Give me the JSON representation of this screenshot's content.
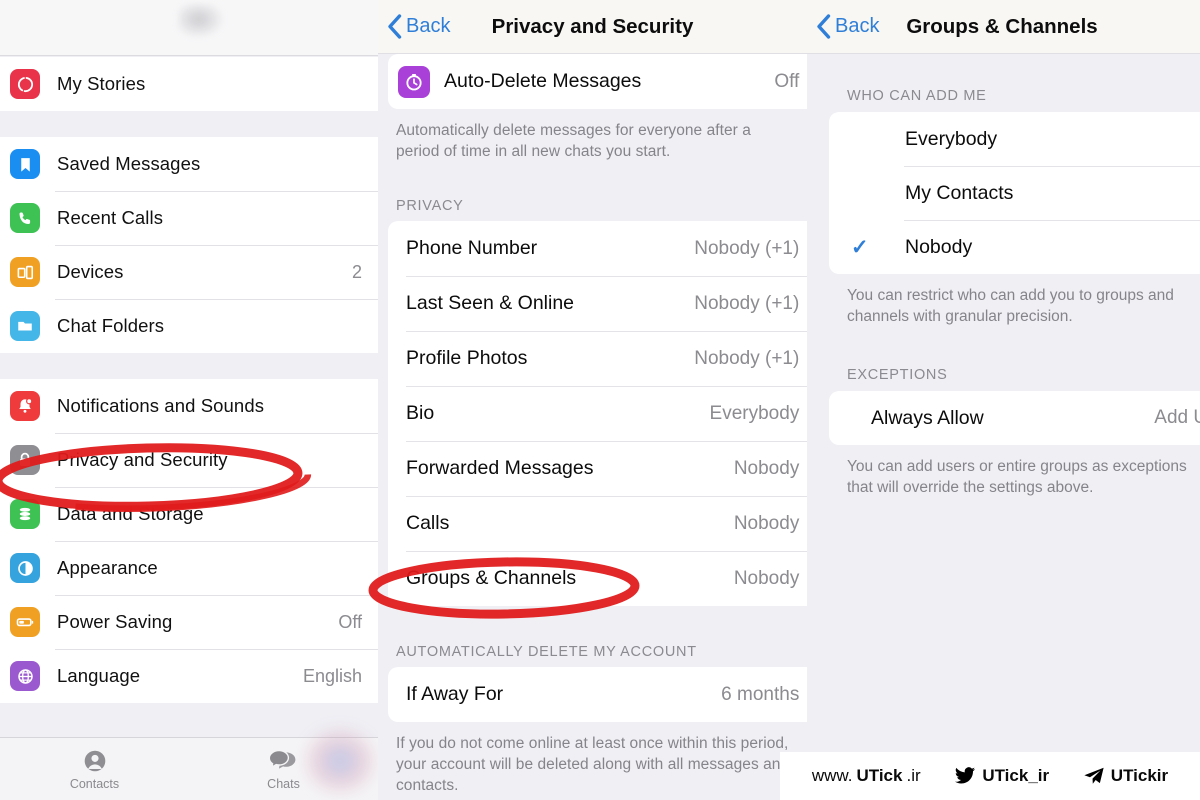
{
  "left_panel": {
    "groups": [
      {
        "rows": [
          {
            "label": "My Stories",
            "value": "",
            "icon": "stories-icon",
            "color": "#e8334a"
          }
        ]
      },
      {
        "rows": [
          {
            "label": "Saved Messages",
            "value": "",
            "icon": "bookmark-icon",
            "color": "#1b8ef2"
          },
          {
            "label": "Recent Calls",
            "value": "",
            "icon": "phone-icon",
            "color": "#3ec254"
          },
          {
            "label": "Devices",
            "value": "2",
            "icon": "devices-icon",
            "color": "#f0a124"
          },
          {
            "label": "Chat Folders",
            "value": "",
            "icon": "folder-icon",
            "color": "#45b6e8"
          }
        ]
      },
      {
        "rows": [
          {
            "label": "Notifications and Sounds",
            "value": "",
            "icon": "bell-icon",
            "color": "#ef3b3b"
          },
          {
            "label": "Privacy and Security",
            "value": "",
            "icon": "lock-icon",
            "color": "#8e8e93"
          },
          {
            "label": "Data and Storage",
            "value": "",
            "icon": "database-icon",
            "color": "#3ec254"
          },
          {
            "label": "Appearance",
            "value": "",
            "icon": "contrast-icon",
            "color": "#35a3dd"
          },
          {
            "label": "Power Saving",
            "value": "Off",
            "icon": "battery-icon",
            "color": "#f0a124"
          },
          {
            "label": "Language",
            "value": "English",
            "icon": "globe-icon",
            "color": "#9b59d0"
          }
        ]
      }
    ],
    "tabbar": [
      {
        "label": "Contacts",
        "icon": "person-icon"
      },
      {
        "label": "Chats",
        "icon": "chat-bubbles-icon"
      }
    ]
  },
  "mid_panel": {
    "nav": {
      "back_label": "Back",
      "title": "Privacy and Security"
    },
    "auto_delete": {
      "label": "Auto-Delete Messages",
      "value": "Off",
      "icon": "timer-icon",
      "color": "#a940d8",
      "footnote": "Automatically delete messages for everyone after a period of time in all new chats you start."
    },
    "privacy_section": {
      "header": "PRIVACY",
      "rows": [
        {
          "label": "Phone Number",
          "value": "Nobody (+1)"
        },
        {
          "label": "Last Seen & Online",
          "value": "Nobody (+1)"
        },
        {
          "label": "Profile Photos",
          "value": "Nobody (+1)"
        },
        {
          "label": "Bio",
          "value": "Everybody"
        },
        {
          "label": "Forwarded Messages",
          "value": "Nobody"
        },
        {
          "label": "Calls",
          "value": "Nobody"
        },
        {
          "label": "Groups & Channels",
          "value": "Nobody"
        }
      ]
    },
    "delete_section": {
      "header": "AUTOMATICALLY DELETE MY ACCOUNT",
      "rows": [
        {
          "label": "If Away For",
          "value": "6 months"
        }
      ],
      "footnote": "If you do not come online at least once within this period, your account will be deleted along with all messages and contacts."
    }
  },
  "right_panel": {
    "nav": {
      "back_label": "Back",
      "title": "Groups & Channels"
    },
    "who_section": {
      "header": "WHO CAN ADD ME",
      "options": [
        {
          "label": "Everybody",
          "selected": false
        },
        {
          "label": "My Contacts",
          "selected": false
        },
        {
          "label": "Nobody",
          "selected": true
        }
      ],
      "footnote": "You can restrict who can add you to groups and channels with granular precision."
    },
    "exceptions_section": {
      "header": "EXCEPTIONS",
      "rows": [
        {
          "label": "Always Allow",
          "value": "Add Users"
        }
      ],
      "footnote": "You can add users or entire groups as exceptions that will override the settings above."
    }
  },
  "watermark": {
    "site_prefix": "www.",
    "site_brand": "UTick",
    "site_tld": ".ir",
    "twitter_handle": "UTick_ir",
    "telegram_handle": "UTickir"
  },
  "annotations": {
    "accent_red": "#e01b1b",
    "items": [
      {
        "name": "privacy-and-security-highlight",
        "target": "Privacy and Security"
      },
      {
        "name": "groups-and-channels-highlight",
        "target": "Groups & Channels"
      }
    ]
  }
}
